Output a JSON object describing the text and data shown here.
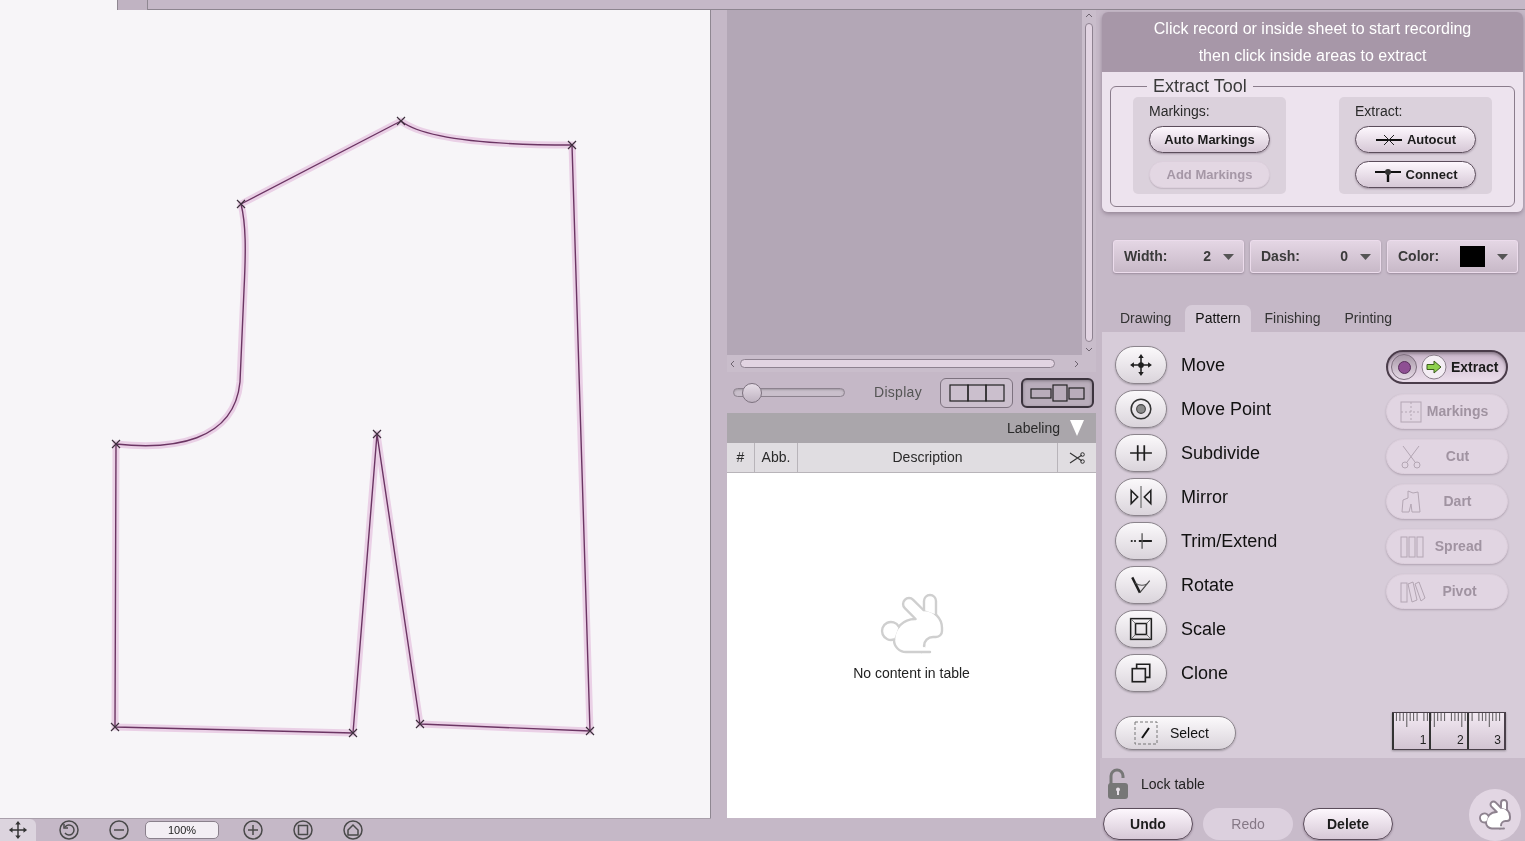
{
  "document_tabs": [
    {
      "selected": true
    },
    {
      "selected": false
    }
  ],
  "zoom_toolbar": {
    "zoom": "100%"
  },
  "display": {
    "label": "Display",
    "slider": {
      "level": 0.1
    },
    "layouts": [
      {
        "kind": "equal",
        "selected": false
      },
      {
        "kind": "mixed",
        "selected": true
      }
    ]
  },
  "labeling": {
    "label": "Labeling"
  },
  "table": {
    "columns": [
      "#",
      "Abb.",
      "Description"
    ],
    "empty_message": "No content in table"
  },
  "hint": {
    "lines": [
      "Click record or inside sheet to start recording",
      "then click inside areas to extract"
    ]
  },
  "extract_tool": {
    "title": "Extract Tool",
    "sections": [
      {
        "label": "Markings:",
        "buttons": [
          {
            "label": "Auto Markings",
            "disabled": false
          },
          {
            "label": "Add Markings",
            "disabled": true
          }
        ]
      },
      {
        "label": "Extract:",
        "buttons": [
          {
            "label": "Autocut",
            "kind": "autocut",
            "disabled": false
          },
          {
            "label": "Connect",
            "kind": "connect",
            "disabled": false
          }
        ]
      }
    ]
  },
  "line_style": [
    {
      "kind": "value",
      "label": "Width:",
      "value": "2"
    },
    {
      "kind": "value",
      "label": "Dash:",
      "value": "0"
    },
    {
      "kind": "color",
      "label": "Color:",
      "color": "#000000"
    }
  ],
  "tabs": [
    {
      "label": "Drawing",
      "selected": false
    },
    {
      "label": "Pattern",
      "selected": true
    },
    {
      "label": "Finishing",
      "selected": false
    },
    {
      "label": "Printing",
      "selected": false
    }
  ],
  "tools": [
    {
      "kind": "move",
      "label": "Move"
    },
    {
      "kind": "move_point",
      "label": "Move Point"
    },
    {
      "kind": "subdivide",
      "label": "Subdivide"
    },
    {
      "kind": "mirror",
      "label": "Mirror"
    },
    {
      "kind": "trim_extend",
      "label": "Trim/Extend"
    },
    {
      "kind": "rotate",
      "label": "Rotate"
    },
    {
      "kind": "scale",
      "label": "Scale"
    },
    {
      "kind": "clone",
      "label": "Clone"
    }
  ],
  "pattern_actions": [
    {
      "kind": "extract",
      "label": "Extract",
      "selected": true,
      "disabled": false
    },
    {
      "kind": "markings",
      "label": "Markings",
      "selected": false,
      "disabled": true
    },
    {
      "kind": "cut",
      "label": "Cut",
      "selected": false,
      "disabled": true
    },
    {
      "kind": "dart",
      "label": "Dart",
      "selected": false,
      "disabled": true
    },
    {
      "kind": "spread",
      "label": "Spread",
      "selected": false,
      "disabled": true
    },
    {
      "kind": "pivot",
      "label": "Pivot",
      "selected": false,
      "disabled": true
    }
  ],
  "select_button": {
    "label": "Select"
  },
  "ruler": {
    "labels": [
      "1",
      "2",
      "3"
    ]
  },
  "lock_table": {
    "label": "Lock table",
    "locked": false
  },
  "history": [
    {
      "label": "Undo",
      "disabled": false
    },
    {
      "label": "Redo",
      "disabled": true
    },
    {
      "label": "Delete",
      "disabled": false
    }
  ]
}
